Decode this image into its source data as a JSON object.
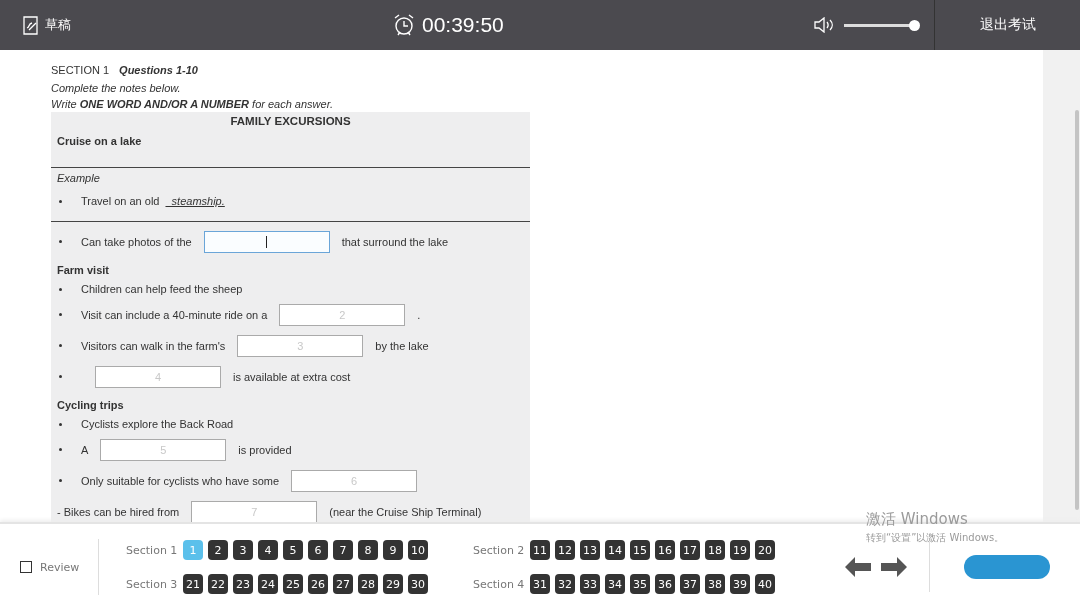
{
  "header": {
    "draft_label": "草稿",
    "timer": "00:39:50",
    "volume": {
      "level": 1
    },
    "exit_label": "退出考试"
  },
  "section": {
    "label": "SECTION 1",
    "questions": "Questions 1-10",
    "instruction_1": "Complete the notes below.",
    "instruction_2": "Write **ONE WORD AND/OR A NUMBER** for each answer."
  },
  "notes": {
    "title": "FAMILY EXCURSIONS",
    "subtitle": "Cruise on a lake",
    "example_label": "Example",
    "example": {
      "prefix": "Travel on an old",
      "answer": "steamship."
    },
    "items": [
      {
        "kind": "bullet",
        "parts": [
          {
            "kind": "text",
            "text": "Can take photos of the"
          },
          {
            "kind": "field",
            "focused": true
          },
          {
            "kind": "text",
            "text": "that surround the lake"
          }
        ]
      },
      {
        "kind": "heading",
        "text": "Farm visit"
      },
      {
        "kind": "bullet",
        "parts": [
          {
            "kind": "text",
            "text": "Children can help feed the sheep"
          }
        ]
      },
      {
        "kind": "bullet",
        "parts": [
          {
            "kind": "text",
            "text": "Visit can include a 40-minute ride on a"
          },
          {
            "kind": "field",
            "placeholder": "2",
            "focused": false
          },
          {
            "kind": "text",
            "text": "."
          }
        ]
      },
      {
        "kind": "bullet",
        "parts": [
          {
            "kind": "text",
            "text": "Visitors can walk in the farm's"
          },
          {
            "kind": "field",
            "placeholder": "3",
            "focused": false
          },
          {
            "kind": "text",
            "text": "by the lake"
          }
        ]
      },
      {
        "kind": "bullet",
        "parts": [
          {
            "kind": "field",
            "placeholder": "4",
            "focused": false
          },
          {
            "kind": "text",
            "text": "is available at extra cost"
          }
        ]
      },
      {
        "kind": "heading",
        "text": "Cycling trips"
      },
      {
        "kind": "bullet",
        "parts": [
          {
            "kind": "text",
            "text": "Cyclists explore the Back Road"
          }
        ]
      },
      {
        "kind": "bullet",
        "parts": [
          {
            "kind": "text",
            "text": "A"
          },
          {
            "kind": "field",
            "placeholder": "5",
            "focused": false
          },
          {
            "kind": "text",
            "text": "is provided"
          }
        ]
      },
      {
        "kind": "bullet",
        "parts": [
          {
            "kind": "text",
            "text": "Only suitable for cyclists who have some"
          },
          {
            "kind": "field",
            "placeholder": "6",
            "focused": false
          }
        ]
      },
      {
        "kind": "dash",
        "parts": [
          {
            "kind": "text",
            "text": "- Bikes can be hired from"
          },
          {
            "kind": "field",
            "placeholder": "7",
            "focused": false
          },
          {
            "kind": "text",
            "text": "(near the Cruise Ship Terminal)"
          }
        ]
      }
    ]
  },
  "review": {
    "label": "Review",
    "checked": false
  },
  "nav": {
    "sections": [
      {
        "label": "Section 1",
        "questions": [
          {
            "number": "1",
            "selected": true
          },
          {
            "number": "2",
            "selected": false
          },
          {
            "number": "3",
            "selected": false
          },
          {
            "number": "4",
            "selected": false
          },
          {
            "number": "5",
            "selected": false
          },
          {
            "number": "6",
            "selected": false
          },
          {
            "number": "7",
            "selected": false
          },
          {
            "number": "8",
            "selected": false
          },
          {
            "number": "9",
            "selected": false
          },
          {
            "number": "10",
            "selected": false
          }
        ]
      },
      {
        "label": "Section 2",
        "questions": [
          {
            "number": "11",
            "selected": false
          },
          {
            "number": "12",
            "selected": false
          },
          {
            "number": "13",
            "selected": false
          },
          {
            "number": "14",
            "selected": false
          },
          {
            "number": "15",
            "selected": false
          },
          {
            "number": "16",
            "selected": false
          },
          {
            "number": "17",
            "selected": false
          },
          {
            "number": "18",
            "selected": false
          },
          {
            "number": "19",
            "selected": false
          },
          {
            "number": "20",
            "selected": false
          }
        ]
      },
      {
        "label": "Section 3",
        "questions": [
          {
            "number": "21",
            "selected": false
          },
          {
            "number": "22",
            "selected": false
          },
          {
            "number": "23",
            "selected": false
          },
          {
            "number": "24",
            "selected": false
          },
          {
            "number": "25",
            "selected": false
          },
          {
            "number": "26",
            "selected": false
          },
          {
            "number": "27",
            "selected": false
          },
          {
            "number": "28",
            "selected": false
          },
          {
            "number": "29",
            "selected": false
          },
          {
            "number": "30",
            "selected": false
          }
        ]
      },
      {
        "label": "Section 4",
        "questions": [
          {
            "number": "31",
            "selected": false
          },
          {
            "number": "32",
            "selected": false
          },
          {
            "number": "33",
            "selected": false
          },
          {
            "number": "34",
            "selected": false
          },
          {
            "number": "35",
            "selected": false
          },
          {
            "number": "36",
            "selected": false
          },
          {
            "number": "37",
            "selected": false
          },
          {
            "number": "38",
            "selected": false
          },
          {
            "number": "39",
            "selected": false
          },
          {
            "number": "40",
            "selected": false
          }
        ]
      }
    ]
  },
  "os_notice": {
    "title": "激活 Windows",
    "text": "转到“设置”以激活 Windows。"
  }
}
